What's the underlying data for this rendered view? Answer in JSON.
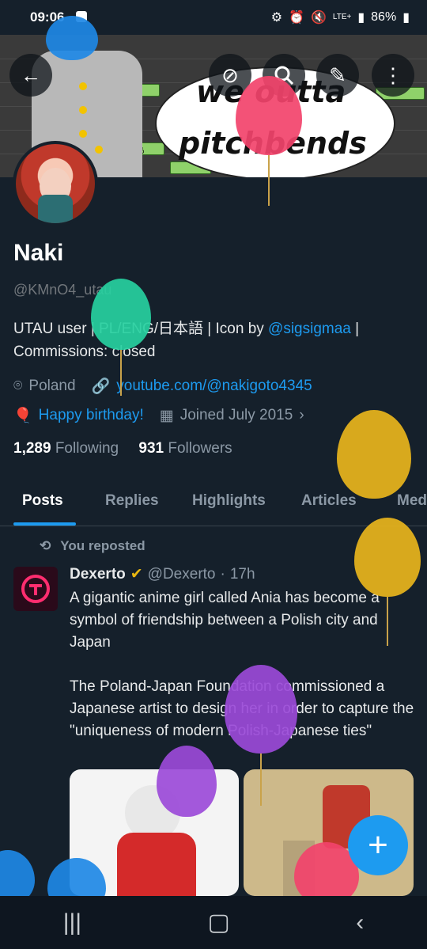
{
  "status": {
    "time": "09:06",
    "battery": "86%",
    "network": "LTE+"
  },
  "banner": {
    "line1": "we outta",
    "line2": "pitchbends",
    "tag": "あ"
  },
  "profile": {
    "name": "Naki",
    "handle": "@KMnO4_utau",
    "bio_prefix": "UTAU user | PL/ENG/日本語 | Icon by ",
    "bio_link": "@sigsigmaa",
    "bio_suffix": " | Commissions: closed",
    "location": "Poland",
    "website": "youtube.com/@nakigoto4345",
    "birthday": "Happy birthday!",
    "joined": "Joined July 2015",
    "following_count": "1,289",
    "following_label": "Following",
    "followers_count": "931",
    "followers_label": "Followers"
  },
  "tabs": [
    "Posts",
    "Replies",
    "Highlights",
    "Articles",
    "Med"
  ],
  "post": {
    "repost_label": "You reposted",
    "author": "Dexerto",
    "author_handle": "@Dexerto",
    "time": "17h",
    "text": "A gigantic anime girl called Ania has become a symbol of friendship between a Polish city and Japan\n\nThe Poland-Japan Foundation commissioned a Japanese artist to design her in order to capture the \"uniqueness of modern Polish-Japanese ties\""
  },
  "colors": {
    "accent": "#1d9bf0",
    "background": "#15202b",
    "verified": "#e8b610"
  },
  "icons": [
    "back-arrow-icon",
    "no-notification-icon",
    "search-icon",
    "edit-icon",
    "more-icon",
    "location-icon",
    "link-icon",
    "birthday-icon",
    "calendar-icon",
    "repost-icon",
    "verified-badge-icon",
    "add-post-icon"
  ]
}
